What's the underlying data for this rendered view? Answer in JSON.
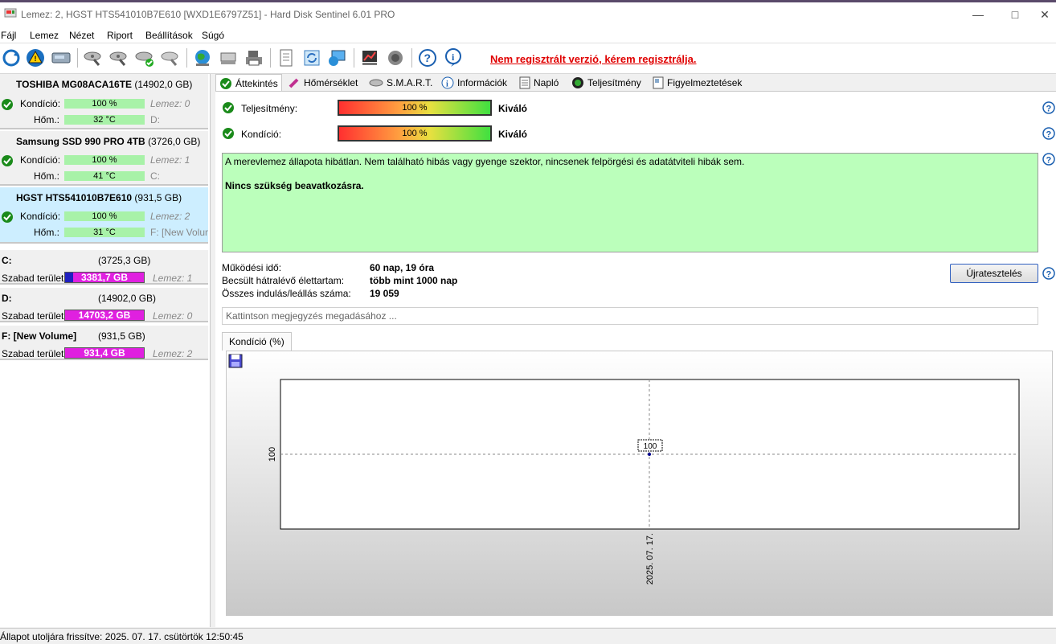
{
  "window": {
    "title": "Lemez: 2, HGST HTS541010B7E610 [WXD1E6797Z51]  -  Hard Disk Sentinel 6.01 PRO"
  },
  "menu": [
    "Fájl",
    "Lemez",
    "Nézet",
    "Riport",
    "Beállítások",
    "Súgó"
  ],
  "toolbar": {
    "register_link": "Nem regisztrált verzió, kérem regisztrálja."
  },
  "disks": [
    {
      "name": "TOSHIBA MG08ACA16TE",
      "size": "(14902,0 GB)",
      "cond_label": "Kondíció:",
      "cond": "100 %",
      "cond_disk": "Lemez: 0",
      "temp_label": "Hőm.:",
      "temp": "32 °C",
      "drive": "D:"
    },
    {
      "name": "Samsung SSD 990 PRO 4TB",
      "size": "(3726,0 GB)",
      "cond_label": "Kondíció:",
      "cond": "100 %",
      "cond_disk": "Lemez: 1",
      "temp_label": "Hőm.:",
      "temp": "41 °C",
      "drive": "C:"
    },
    {
      "name": "HGST HTS541010B7E610",
      "size": "(931,5 GB)",
      "cond_label": "Kondíció:",
      "cond": "100 %",
      "cond_disk": "Lemez: 2",
      "temp_label": "Hőm.:",
      "temp": "31 °C",
      "drive": "F: [New Volume]"
    }
  ],
  "partitions": [
    {
      "name": "C:",
      "size": "(3725,3 GB)",
      "free_label": "Szabad terület",
      "free": "3381,7 GB",
      "disk": "Lemez: 1"
    },
    {
      "name": "D:",
      "size": "(14902,0 GB)",
      "free_label": "Szabad terület",
      "free": "14703,2 GB",
      "disk": "Lemez: 0"
    },
    {
      "name": "F: [New Volume]",
      "size": "(931,5 GB)",
      "free_label": "Szabad terület",
      "free": "931,4 GB",
      "disk": "Lemez: 2"
    }
  ],
  "tabs": [
    "Áttekintés",
    "Hőmérséklet",
    "S.M.A.R.T.",
    "Információk",
    "Napló",
    "Teljesítmény",
    "Figyelmeztetések"
  ],
  "overview": {
    "perf_label": "Teljesítmény:",
    "perf_value": "100 %",
    "perf_rating": "Kiváló",
    "cond_label": "Kondíció:",
    "cond_value": "100 %",
    "cond_rating": "Kiváló",
    "status_text": "A merevlemez állapota hibátlan. Nem található hibás vagy gyenge szektor, nincsenek felpörgési és adatátviteli hibák sem.",
    "status_action": "Nincs szükség beavatkozásra.",
    "uptime_label": "Működési idő:",
    "uptime": "60 nap, 19 óra",
    "life_label": "Becsült hátralévő élettartam:",
    "life": "több mint 1000 nap",
    "starts_label": "Összes indulás/leállás száma:",
    "starts": "19 059",
    "retest_button": "Újratesztelés",
    "note_placeholder": "Kattintson megjegyzés megadásához ...",
    "chart_tab": "Kondíció  (%)"
  },
  "chart_data": {
    "type": "line",
    "x": [
      "2025. 07. 17."
    ],
    "series": [
      {
        "values": [
          100
        ]
      }
    ],
    "data_labels": [
      "100"
    ],
    "y_tick": "100",
    "grid": true
  },
  "status": {
    "text": "Állapot utoljára frissítve: 2025. 07. 17. csütörtök 12:50:45"
  },
  "colors": {
    "register": "#e00000",
    "status_ok": "#bbffbb",
    "free_space": "#e020e0",
    "condition_bar": "#a8f2a8"
  }
}
